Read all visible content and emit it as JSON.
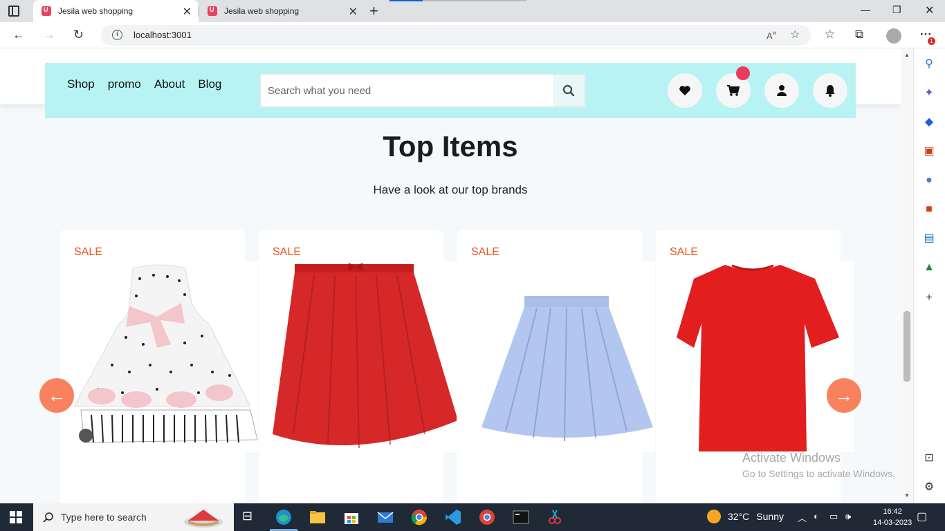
{
  "browser": {
    "tabs": [
      {
        "title": "Jesila web shopping",
        "active": true
      },
      {
        "title": "Jesila web shopping",
        "active": false
      }
    ],
    "url": "localhost:3001"
  },
  "store": {
    "nav": [
      "Shop",
      "promo",
      "About",
      "Blog"
    ],
    "search_placeholder": "Search what you need",
    "header_icons": [
      "heart-icon",
      "cart-icon",
      "user-icon",
      "bell-icon"
    ],
    "cart_badge_color": "#ea3b5c",
    "header_bg": "#b8f3f3"
  },
  "section": {
    "title": "Top Items",
    "subtitle": "Have a look at our top brands"
  },
  "products": [
    {
      "badge": "SALE",
      "image": "polka-dot-dress"
    },
    {
      "badge": "SALE",
      "image": "red-skirt"
    },
    {
      "badge": "SALE",
      "image": "blue-pleated-skirt"
    },
    {
      "badge": "SALE",
      "image": "red-tshirt"
    }
  ],
  "watermark": {
    "line1": "Activate Windows",
    "line2": "Go to Settings to activate Windows."
  },
  "taskbar": {
    "search_placeholder": "Type here to search",
    "weather": {
      "temp": "32°C",
      "condition": "Sunny"
    },
    "time": "16:42",
    "date": "14-03-2023"
  },
  "colors": {
    "sale": "#f0531e",
    "arrow": "#f9825e"
  }
}
